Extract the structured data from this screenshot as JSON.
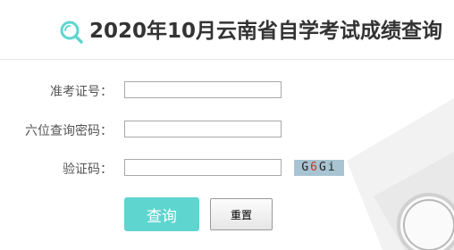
{
  "header": {
    "title": "2020年10月云南省自学考试成绩查询",
    "icon": "search-icon",
    "accent_color": "#5fd5cf"
  },
  "form": {
    "exam_id": {
      "label": "准考证号：",
      "value": ""
    },
    "id_last6": {
      "label": "六位查询密码：",
      "value": ""
    },
    "captcha": {
      "label": "验证码：",
      "value": "",
      "image_text": [
        "G",
        "6",
        "Gi"
      ]
    }
  },
  "buttons": {
    "query": "查询",
    "reset": "重置"
  }
}
